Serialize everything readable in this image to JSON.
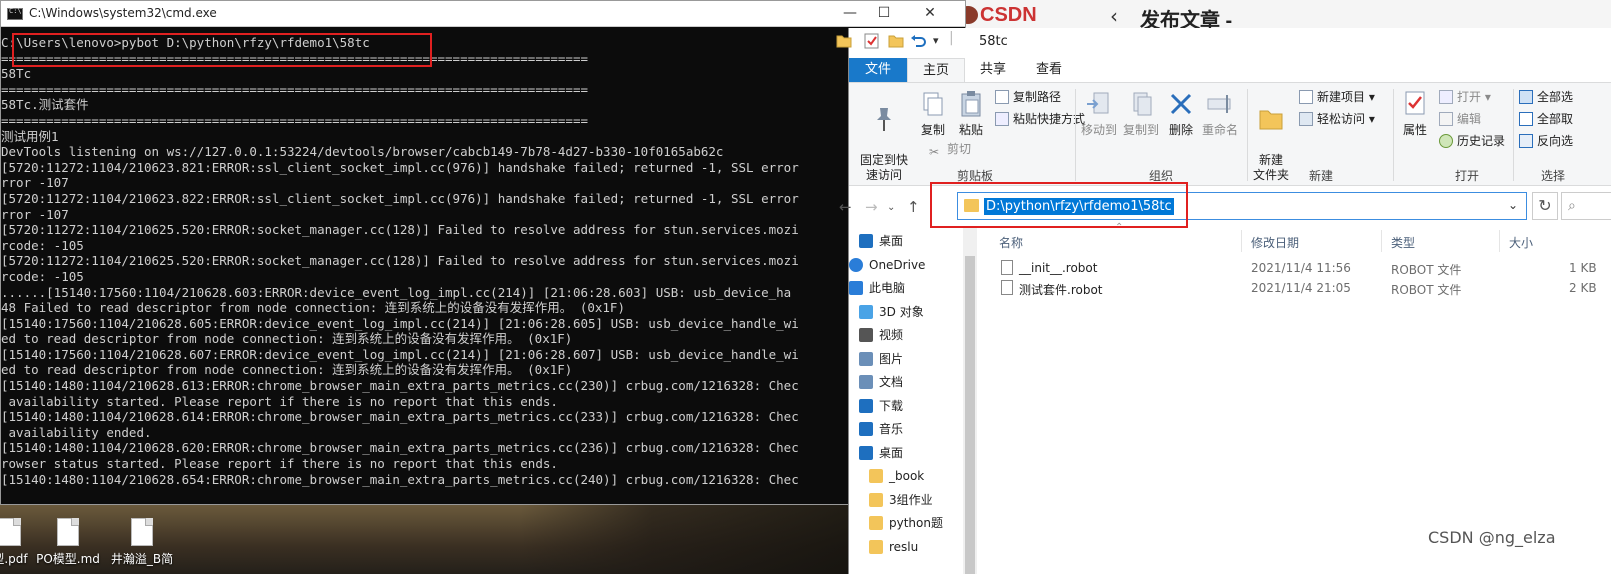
{
  "cmd": {
    "title": "C:\\Windows\\system32\\cmd.exe",
    "buttons": {
      "minimize": "—",
      "maximize": "☐",
      "close": "✕"
    },
    "lines": [
      "C:\\Users\\lenovo>pybot D:\\python\\rfzy\\rfdemo1\\58tc",
      "==============================================================================",
      "58Tc",
      "==============================================================================",
      "58Tc.测试套件",
      "==============================================================================",
      "测试用例1",
      "DevTools listening on ws://127.0.0.1:53224/devtools/browser/cabcb149-7b78-4d27-b330-10f0165ab62c",
      "[5720:11272:1104/210623.821:ERROR:ssl_client_socket_impl.cc(976)] handshake failed; returned -1, SSL error",
      "rror -107",
      "[5720:11272:1104/210623.822:ERROR:ssl_client_socket_impl.cc(976)] handshake failed; returned -1, SSL error",
      "rror -107",
      "[5720:11272:1104/210625.520:ERROR:socket_manager.cc(128)] Failed to resolve address for stun.services.mozi",
      "rcode: -105",
      "[5720:11272:1104/210625.520:ERROR:socket_manager.cc(128)] Failed to resolve address for stun.services.mozi",
      "rcode: -105",
      "......[15140:17560:1104/210628.603:ERROR:device_event_log_impl.cc(214)] [21:06:28.603] USB: usb_device_ha",
      "48 Failed to read descriptor from node connection: 连到系统上的设备没有发挥作用。 (0x1F)",
      "[15140:17560:1104/210628.605:ERROR:device_event_log_impl.cc(214)] [21:06:28.605] USB: usb_device_handle_wi",
      "ed to read descriptor from node connection: 连到系统上的设备没有发挥作用。 (0x1F)",
      "[15140:17560:1104/210628.607:ERROR:device_event_log_impl.cc(214)] [21:06:28.607] USB: usb_device_handle_wi",
      "ed to read descriptor from node connection: 连到系统上的设备没有发挥作用。 (0x1F)",
      "[15140:1480:1104/210628.613:ERROR:chrome_browser_main_extra_parts_metrics.cc(230)] crbug.com/1216328: Chec",
      " availability started. Please report if there is no report that this ends.",
      "[15140:1480:1104/210628.614:ERROR:chrome_browser_main_extra_parts_metrics.cc(233)] crbug.com/1216328: Chec",
      " availability ended.",
      "[15140:1480:1104/210628.620:ERROR:chrome_browser_main_extra_parts_metrics.cc(236)] crbug.com/1216328: Chec",
      "rowser status started. Please report if there is no report that this ends.",
      "[15140:1480:1104/210628.654:ERROR:chrome_browser_main_extra_parts_metrics.cc(240)] crbug.com/1216328: Chec"
    ]
  },
  "desktop": {
    "icons": [
      {
        "label": "型.pdf"
      },
      {
        "label": "PO模型.md"
      },
      {
        "label": "井瀚溢_B简"
      }
    ]
  },
  "csdn": {
    "logo": "CSDN",
    "back": "‹",
    "title": "发布文章 -"
  },
  "explorer": {
    "title": "58tc",
    "tabs": {
      "file": "文件",
      "home": "主页",
      "share": "共享",
      "view": "查看"
    },
    "ribbon": {
      "pin": "固定到快\n速访问",
      "copy": "复制",
      "paste": "粘贴",
      "copy_path": "复制路径",
      "paste_shortcut": "粘贴快捷方式",
      "cut": "剪切",
      "group_clipboard": "剪贴板",
      "move_to": "移动到",
      "copy_to": "复制到",
      "delete": "删除",
      "rename": "重命名",
      "group_organize": "组织",
      "new_folder": "新建\n文件夹",
      "new_item": "新建项目 ▾",
      "easy_access": "轻松访问 ▾",
      "group_new": "新建",
      "properties": "属性",
      "open": "打开 ▾",
      "edit": "编辑",
      "history": "历史记录",
      "group_open": "打开",
      "select_all": "全部选",
      "select_none": "全部取",
      "invert": "反向选",
      "group_select": "选择"
    },
    "address": "D:\\python\\rfzy\\rfdemo1\\58tc",
    "search_icon": "⌕",
    "nav_items": [
      {
        "label": "桌面",
        "icon": "desktop-icon",
        "color": "#1e6fbf",
        "indent": 1
      },
      {
        "label": "OneDrive",
        "icon": "cloud-icon",
        "color": "#2a7dd8",
        "indent": 0
      },
      {
        "label": "此电脑",
        "icon": "computer-icon",
        "color": "#2a7dd8",
        "indent": 0
      },
      {
        "label": "3D 对象",
        "icon": "cube-icon",
        "color": "#4aa3e6",
        "indent": 1
      },
      {
        "label": "视频",
        "icon": "video-icon",
        "color": "#555555",
        "indent": 1
      },
      {
        "label": "图片",
        "icon": "picture-icon",
        "color": "#6b8fb8",
        "indent": 1
      },
      {
        "label": "文档",
        "icon": "document-icon",
        "color": "#6b8fb8",
        "indent": 1
      },
      {
        "label": "下载",
        "icon": "download-icon",
        "color": "#1e6fbf",
        "indent": 1
      },
      {
        "label": "音乐",
        "icon": "music-icon",
        "color": "#1e6fbf",
        "indent": 1
      },
      {
        "label": "桌面",
        "icon": "desktop-icon",
        "color": "#1e6fbf",
        "indent": 1
      },
      {
        "label": "_book",
        "icon": "folder-icon",
        "color": "#f3c55a",
        "indent": 2
      },
      {
        "label": "3组作业",
        "icon": "folder-icon",
        "color": "#f3c55a",
        "indent": 2
      },
      {
        "label": "python题",
        "icon": "folder-icon",
        "color": "#f3c55a",
        "indent": 2
      },
      {
        "label": "reslu",
        "icon": "folder-icon",
        "color": "#f3c55a",
        "indent": 2
      }
    ],
    "columns": {
      "name": "名称",
      "modified": "修改日期",
      "type": "类型",
      "size": "大小"
    },
    "files": [
      {
        "name": "__init__.robot",
        "modified": "2021/11/4 11:56",
        "type": "ROBOT 文件",
        "size": "1 KB"
      },
      {
        "name": "测试套件.robot",
        "modified": "2021/11/4 21:05",
        "type": "ROBOT 文件",
        "size": "2 KB"
      }
    ]
  },
  "watermark": "CSDN @ng_elza"
}
